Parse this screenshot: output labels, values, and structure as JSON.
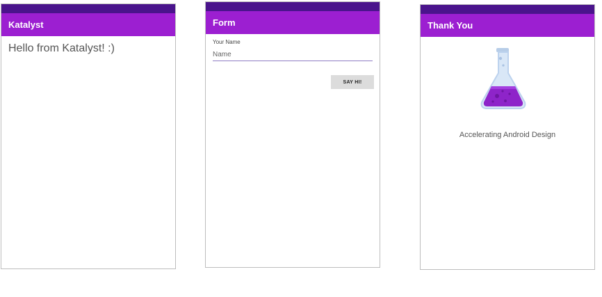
{
  "screens": {
    "katalyst": {
      "title": "Katalyst",
      "message": "Hello from Katalyst! :)"
    },
    "form": {
      "title": "Form",
      "field_label": "Your Name",
      "field_placeholder": "Name",
      "button_label": "SAY HI!"
    },
    "thank_you": {
      "title": "Thank You",
      "logo_icon": "flask-icon",
      "tagline": "Accelerating Android Design"
    }
  },
  "colors": {
    "status_bar": "#4a148c",
    "app_bar": "#9c1fd1",
    "flask_liquid": "#8e24c9",
    "flask_glass": "#c8dcf4"
  }
}
